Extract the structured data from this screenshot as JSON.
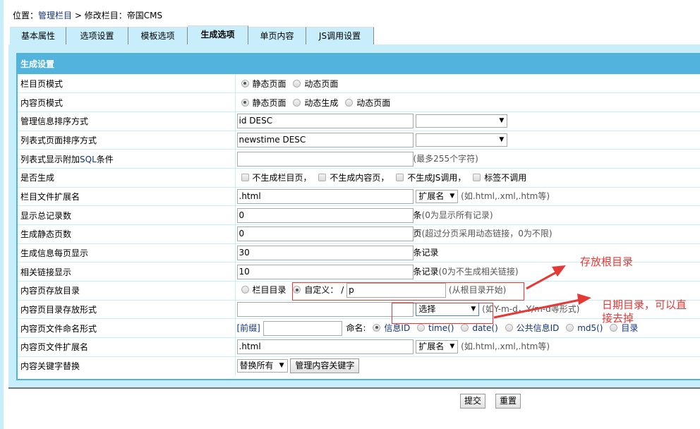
{
  "breadcrumb": {
    "prefix": "位置：",
    "link": "管理栏目",
    "separator": " > ",
    "current": "修改栏目：帝国CMS"
  },
  "tabs": [
    {
      "label": "基本属性",
      "active": false
    },
    {
      "label": "选项设置",
      "active": false
    },
    {
      "label": "模板选项",
      "active": false
    },
    {
      "label": "生成选项",
      "active": true
    },
    {
      "label": "单页内容",
      "active": false
    },
    {
      "label": "JS调用设置",
      "active": false
    }
  ],
  "section_title": "生成设置",
  "rows": {
    "list_mode": {
      "label": "栏目页模式",
      "options": [
        {
          "label": "静态页面",
          "checked": true
        },
        {
          "label": "动态页面",
          "checked": false
        }
      ]
    },
    "content_mode": {
      "label": "内容页模式",
      "options": [
        {
          "label": "静态页面",
          "checked": true
        },
        {
          "label": "动态生成",
          "checked": false
        },
        {
          "label": "动态页面",
          "checked": false
        }
      ]
    },
    "admin_order": {
      "label": "管理信息排序方式",
      "value": "id DESC",
      "select": ""
    },
    "list_order": {
      "label": "列表式页面排序方式",
      "value": "newstime DESC",
      "select": ""
    },
    "list_sql": {
      "label_a": "列表式显示附加",
      "label_sql": "SQL",
      "label_b": "条件",
      "value": "",
      "hint": "(最多255个字符)"
    },
    "generate": {
      "label": "是否生成",
      "options": [
        {
          "label": "不生成栏目页，",
          "checked": false
        },
        {
          "label": "不生成内容页，",
          "checked": false
        },
        {
          "label": "不生成JS调用，",
          "checked": false
        },
        {
          "label": "标签不调用",
          "checked": false
        }
      ]
    },
    "list_ext": {
      "label": "栏目文件扩展名",
      "value": ".html",
      "select": "扩展名",
      "hint": "(如.html,.xml,.htm等)"
    },
    "total_records": {
      "label": "显示总记录数",
      "value": "0",
      "unit": "条",
      "hint": "(0为显示所有记录)"
    },
    "static_pages": {
      "label": "生成静态页数",
      "value": "0",
      "unit": "页",
      "hint": "(超过分页采用动态链接，0为不限)"
    },
    "per_page": {
      "label": "生成信息每页显示",
      "value": "30",
      "unit": "条记录"
    },
    "related_links": {
      "label": "相关链接显示",
      "value": "10",
      "unit": "条记录",
      "hint": "(0为不生成相关链接)"
    },
    "content_dir": {
      "label": "内容页存放目录",
      "option_column": {
        "label": "栏目目录",
        "checked": false
      },
      "option_custom": {
        "label": "自定义：",
        "checked": true
      },
      "slash": "/",
      "value": "p",
      "hint": "(从根目录开始)"
    },
    "dir_format": {
      "label": "内容页目录存放形式",
      "value": "",
      "select": "选择",
      "hint": "(如Y-m-d，Y/m-d等形式)"
    },
    "file_naming": {
      "label": "内容页文件命名形式",
      "prefix_label": "[前缀]",
      "prefix_value": "",
      "name_label": "命名:",
      "options": [
        {
          "label": "信息ID",
          "checked": true
        },
        {
          "label": "time()",
          "checked": false
        },
        {
          "label": "date()",
          "checked": false
        },
        {
          "label": "公共信息ID",
          "checked": false
        },
        {
          "label": "md5()",
          "checked": false
        },
        {
          "label": "目录",
          "checked": false
        }
      ]
    },
    "content_ext": {
      "label": "内容页文件扩展名",
      "value": ".html",
      "select": "扩展名",
      "hint": "(如.html,.xml,.htm等)"
    },
    "keyword_replace": {
      "label": "内容关键字替换",
      "select": "替换所有",
      "button": "管理内容关键字"
    }
  },
  "buttons": {
    "submit": "提交",
    "reset": "重置"
  },
  "annotations": {
    "root_dir": "存放根目录",
    "date_dir_line1": "日期目录，可以直",
    "date_dir_line2": "接去掉",
    "color": "#e53935"
  }
}
